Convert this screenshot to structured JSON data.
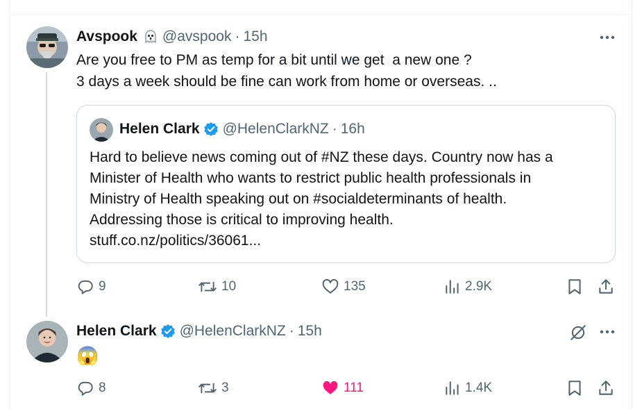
{
  "colors": {
    "text": "#0f1419",
    "muted": "#536471",
    "border": "#cfd9de",
    "verified": "#1d9bf0",
    "like": "#f91880"
  },
  "tweet1": {
    "name": "Avspook",
    "handle": "@avspook",
    "sep": "·",
    "time": "15h",
    "lines": [
      "Are you free to PM as temp for a bit until we get  a new one ?",
      "3 days a week should be fine can work from home or overseas. .."
    ],
    "badge_icon": "ghost-icon",
    "quote": {
      "name": "Helen Clark",
      "handle": "@HelenClarkNZ",
      "sep": "·",
      "time": "16h",
      "lines": [
        "Hard to believe news coming out of #NZ these days. Country now has a",
        "Minister of Health who wants to restrict public health professionals in",
        "Ministry of Health speaking out on #socialdeterminants of health.",
        "Addressing those is critical to improving health.",
        "stuff.co.nz/politics/36061..."
      ]
    },
    "actions": {
      "replies": "9",
      "reposts": "10",
      "likes": "135",
      "views": "2.9K"
    }
  },
  "tweet2": {
    "name": "Helen Clark",
    "handle": "@HelenClarkNZ",
    "sep": "·",
    "time": "15h",
    "emoji": "😱",
    "actions": {
      "replies": "8",
      "reposts": "3",
      "likes": "111",
      "views": "1.4K"
    }
  }
}
